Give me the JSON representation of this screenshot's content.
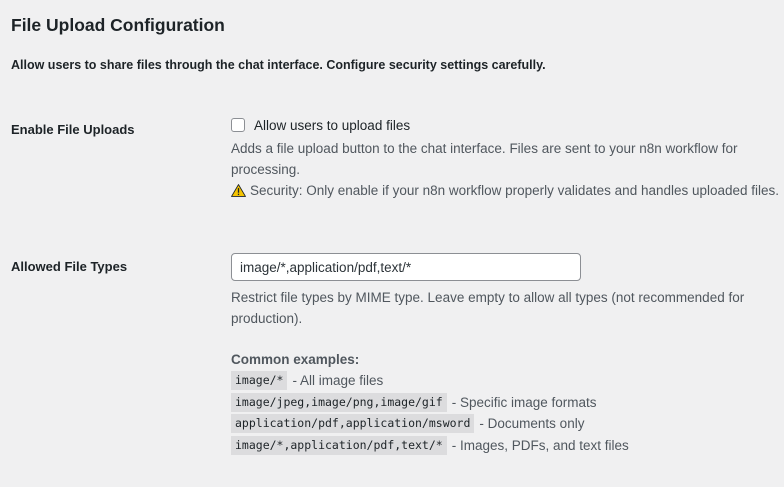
{
  "section": {
    "title": "File Upload Configuration",
    "description": "Allow users to share files through the chat interface. Configure security settings carefully."
  },
  "enable_uploads": {
    "label": "Enable File Uploads",
    "checkbox_label": "Allow users to upload files",
    "checked": false,
    "help": "Adds a file upload button to the chat interface. Files are sent to your n8n workflow for processing.",
    "warning_icon": "warning-icon",
    "warning": "Security: Only enable if your n8n workflow properly validates and handles uploaded files."
  },
  "allowed_types": {
    "label": "Allowed File Types",
    "value": "image/*,application/pdf,text/*",
    "help": "Restrict file types by MIME type. Leave empty to allow all types (not recommended for production).",
    "examples_title": "Common examples:",
    "examples": [
      {
        "code": "image/*",
        "desc": "- All image files"
      },
      {
        "code": "image/jpeg,image/png,image/gif",
        "desc": "- Specific image formats"
      },
      {
        "code": "application/pdf,application/msword",
        "desc": "- Documents only"
      },
      {
        "code": "image/*,application/pdf,text/*",
        "desc": "- Images, PDFs, and text files"
      }
    ]
  }
}
